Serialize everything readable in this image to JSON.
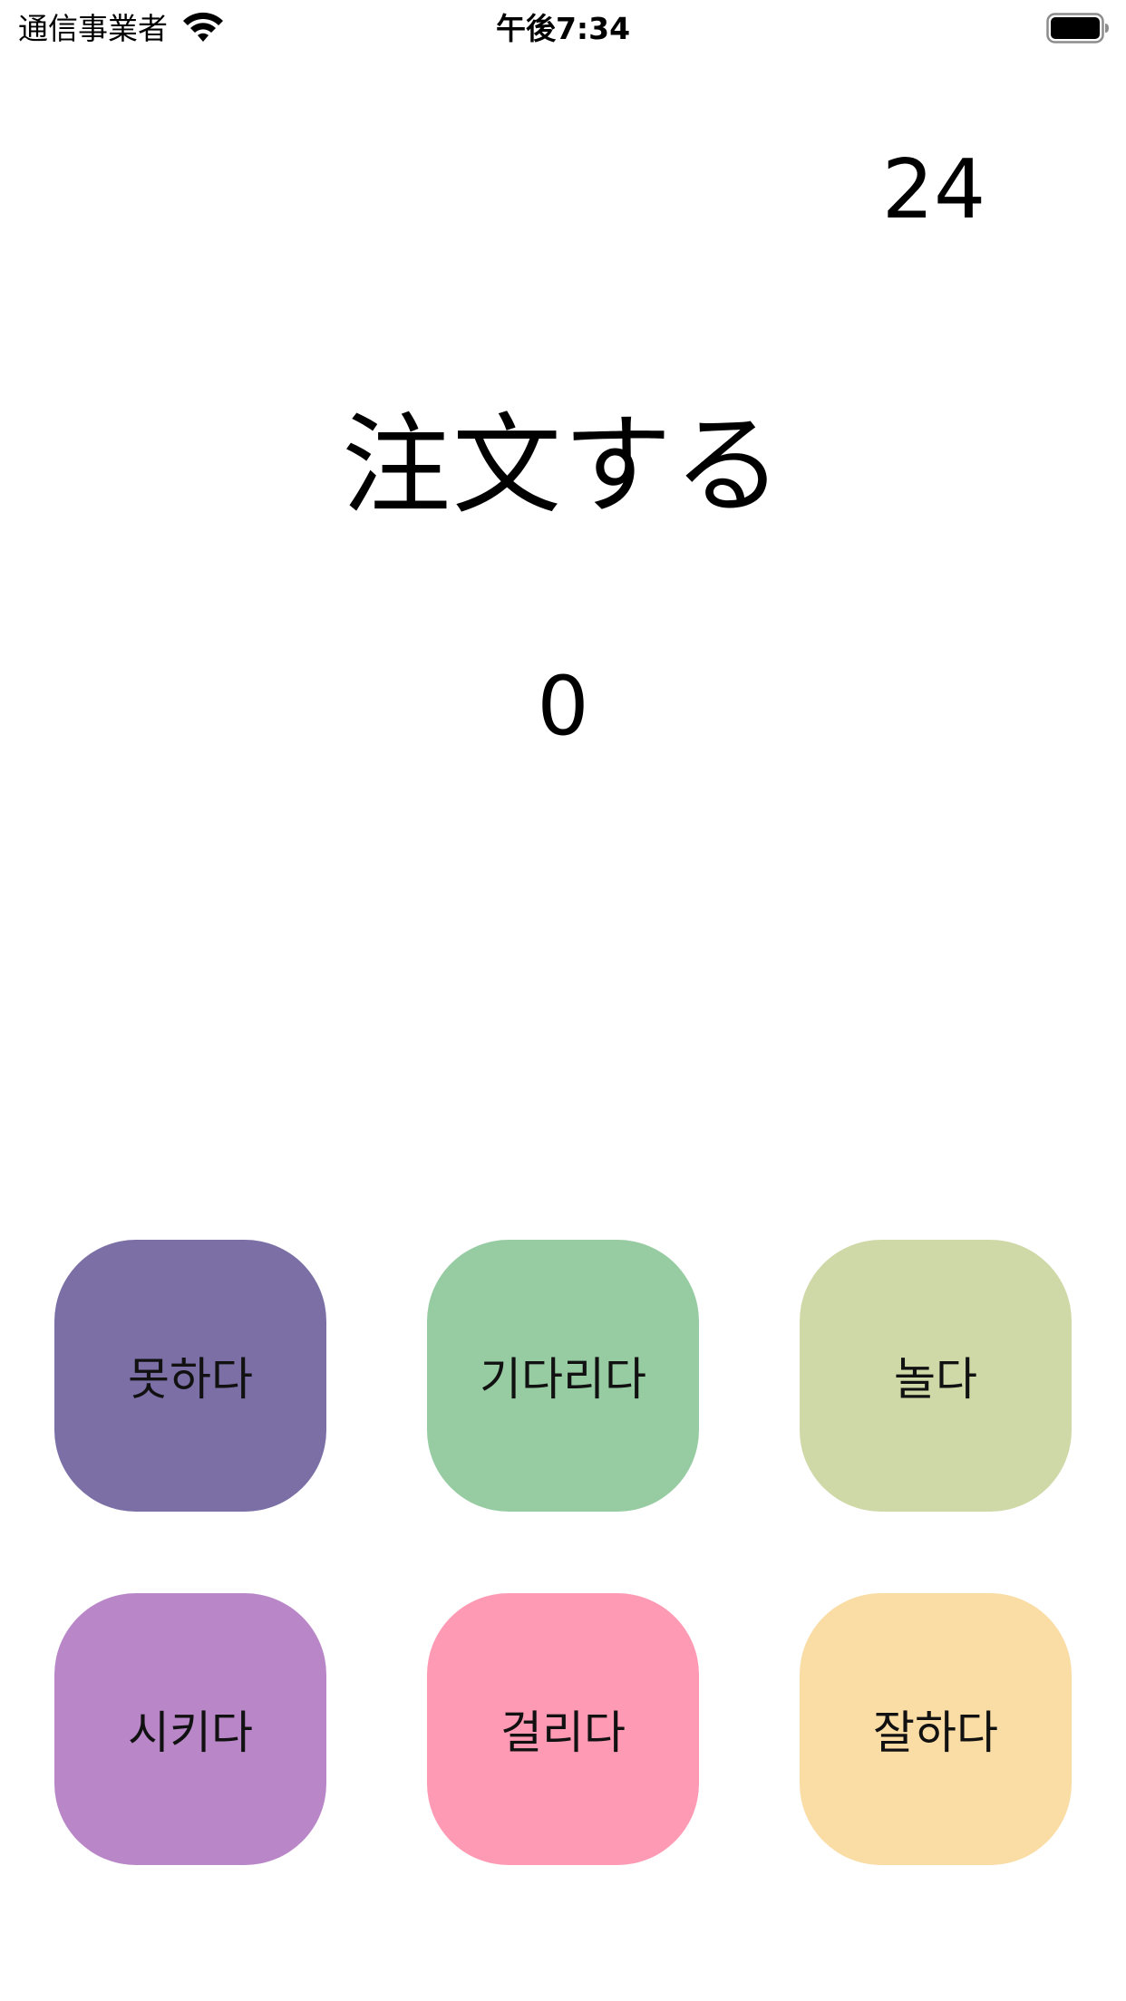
{
  "status_bar": {
    "carrier": "通信事業者",
    "time": "午後7:34",
    "wifi_icon": "wifi-icon",
    "battery_icon": "battery-icon"
  },
  "quiz": {
    "timer": "24",
    "word": "注文する",
    "score": "0"
  },
  "answers": [
    {
      "label": "못하다",
      "color": "#7B6FA6"
    },
    {
      "label": "기다리다",
      "color": "#97CCA3"
    },
    {
      "label": "놀다",
      "color": "#CFD8A7"
    },
    {
      "label": "시키다",
      "color": "#B987C8"
    },
    {
      "label": "걸리다",
      "color": "#FF9AB5"
    },
    {
      "label": "잘하다",
      "color": "#FADCA5"
    }
  ]
}
